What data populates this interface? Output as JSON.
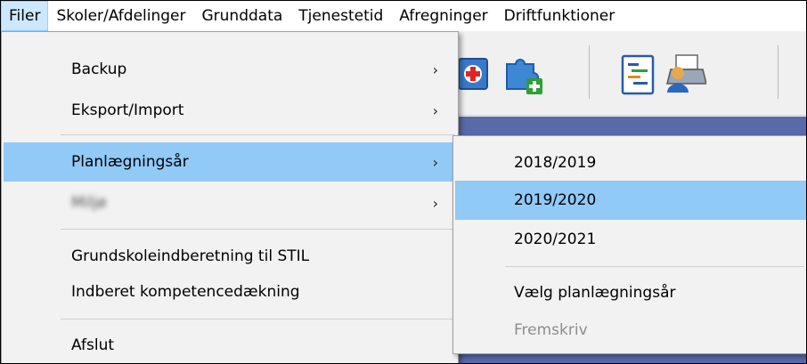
{
  "menubar": {
    "items": [
      "Filer",
      "Skoler/Afdelinger",
      "Grunddata",
      "Tjenestetid",
      "Afregninger",
      "Driftfunktioner"
    ]
  },
  "file_menu": {
    "backup": "Backup",
    "export_import": "Eksport/Import",
    "planning_year": "Planlægningsår",
    "environment": "Miljø",
    "stil_report": "Grundskoleindberetning til STIL",
    "competence_report": "Indberet kompetencedækning",
    "exit": "Afslut",
    "submenu_arrow": "›"
  },
  "planning_submenu": {
    "years": [
      "2018/2019",
      "2019/2020",
      "2020/2021"
    ],
    "select_year": "Vælg planlægningsår",
    "advance": "Fremskriv"
  },
  "icons": [
    "medical-kit-icon",
    "puzzle-add-icon",
    "schedule-list-icon",
    "user-printer-icon"
  ],
  "colors": {
    "highlight": "#91c9f7",
    "menubar_active": "#cce8ff",
    "app_background": "#5a6aa8"
  }
}
